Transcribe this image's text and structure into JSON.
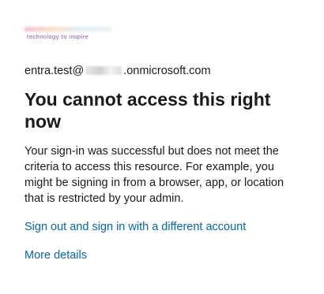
{
  "branding": {
    "logo_icon": "company-logo",
    "tagline": "technology to inspire"
  },
  "identity": {
    "prefix": "entra.test@",
    "suffix": ".onmicrosoft.com"
  },
  "message": {
    "title": "You cannot access this right now",
    "body": "Your sign-in was successful but does not meet the criteria to access this resource. For example, you might be signing in from a browser, app, or location that is restricted by your admin."
  },
  "actions": {
    "sign_out_label": "Sign out and sign in with a different account",
    "more_details_label": "More details"
  },
  "colors": {
    "link": "#0067b8",
    "text": "#1b1b1b",
    "background": "#ffffff"
  }
}
